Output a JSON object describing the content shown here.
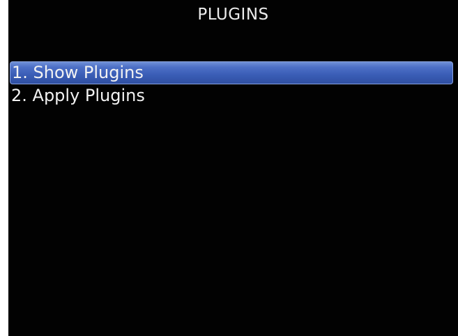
{
  "header": {
    "title": "PLUGINS"
  },
  "menu": {
    "items": [
      {
        "label": "1. Show Plugins",
        "selected": true
      },
      {
        "label": "2. Apply Plugins",
        "selected": false
      }
    ]
  },
  "colors": {
    "background": "#020202",
    "text": "#f2f2f2",
    "highlight": "#3a5db6"
  }
}
